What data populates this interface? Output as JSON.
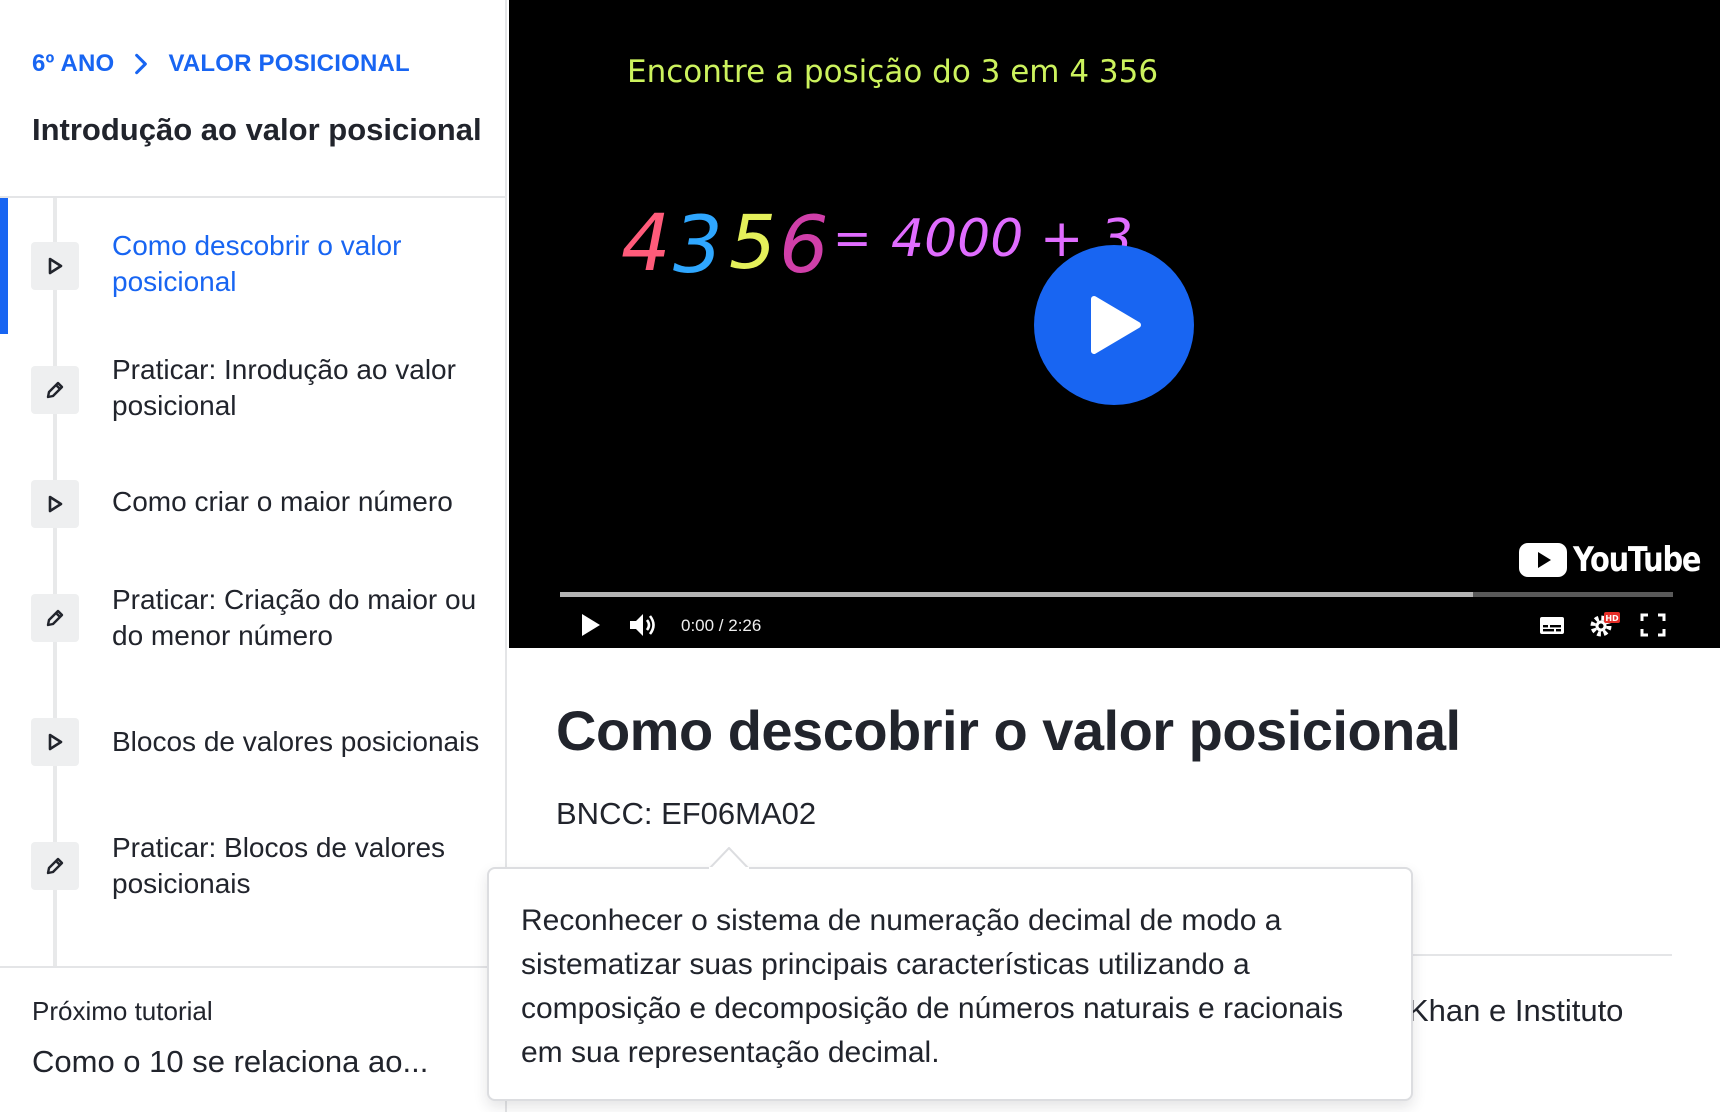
{
  "sidebar": {
    "breadcrumb": {
      "grade": "6º ANO",
      "unit": "VALOR POSICIONAL"
    },
    "title": "Introdução ao valor posicional",
    "items": [
      {
        "label": "Como descobrir o valor posicional",
        "icon": "play-icon",
        "active": true
      },
      {
        "label": "Praticar: Inrodução ao valor posicional",
        "icon": "pencil-icon",
        "active": false
      },
      {
        "label": "Como criar o maior número",
        "icon": "play-icon",
        "active": false
      },
      {
        "label": "Praticar: Criação do maior ou do menor número",
        "icon": "pencil-icon",
        "active": false
      },
      {
        "label": "Blocos de valores posicionais",
        "icon": "play-icon",
        "active": false
      },
      {
        "label": "Praticar: Blocos de valores posicionais",
        "icon": "pencil-icon",
        "active": false
      }
    ],
    "next": {
      "caption": "Próximo tutorial",
      "title": "Como o 10 se relaciona ao..."
    }
  },
  "video": {
    "headline": "Encontre a posição do 3 em 4 356",
    "handwriting": {
      "digits": [
        "4",
        "3",
        "5",
        "6"
      ],
      "equals": "=",
      "expansion": "4000 + 3"
    },
    "time": "0:00 / 2:26",
    "progress_loaded": 0.82,
    "brand": "YouTube",
    "hd_badge": "HD",
    "icons": [
      "big-play-icon",
      "play-icon",
      "volume-icon",
      "captions-icon",
      "settings-icon",
      "fullscreen-icon"
    ]
  },
  "content": {
    "title": "Como descobrir o valor posicional",
    "bncc": "BNCC: EF06MA02",
    "credit_fragment": "Khan e Instituto"
  },
  "tooltip": {
    "text": "Reconhecer o sistema de numeração decimal de modo a sistematizar suas principais características utilizando a composição e decomposição de números naturais e racionais em sua representação decimal."
  },
  "colors": {
    "accent": "#1865f2",
    "text": "#21242c",
    "video_headline": "#ccf25d",
    "digit_colors": [
      "#ff5b7a",
      "#2fa7ff",
      "#e4f05a",
      "#d03fa9"
    ],
    "expansion": "#e06cff",
    "plus": "#4ab0ff"
  }
}
